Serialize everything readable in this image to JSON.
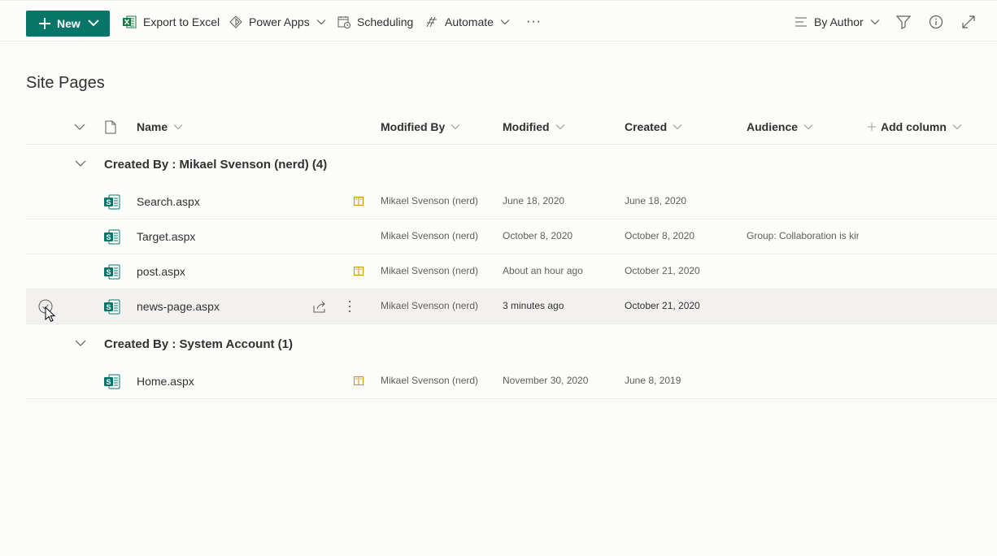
{
  "toolbar": {
    "new_label": "New",
    "export_label": "Export to Excel",
    "powerapps_label": "Power Apps",
    "scheduling_label": "Scheduling",
    "automate_label": "Automate",
    "more_label": "···",
    "view_label": "By Author"
  },
  "page": {
    "title": "Site Pages"
  },
  "columns": {
    "name": "Name",
    "modified_by": "Modified By",
    "modified": "Modified",
    "created": "Created",
    "audience": "Audience",
    "add_column": "Add column"
  },
  "groups": [
    {
      "title": "Created By : Mikael Svenson (nerd) (4)",
      "rows": [
        {
          "name": "Search.aspx",
          "modified_by": "Mikael Svenson (nerd)",
          "modified": "June 18, 2020",
          "created": "June 18, 2020",
          "audience": ""
        },
        {
          "name": "Target.aspx",
          "modified_by": "Mikael Svenson (nerd)",
          "modified": "October 8, 2020",
          "created": "October 8, 2020",
          "audience": "Group: Collaboration is kir"
        },
        {
          "name": "post.aspx",
          "modified_by": "Mikael Svenson (nerd)",
          "modified": "About an hour ago",
          "created": "October 21, 2020",
          "audience": ""
        },
        {
          "name": "news-page.aspx",
          "modified_by": "Mikael Svenson (nerd)",
          "modified": "3 minutes ago",
          "created": "October 21, 2020",
          "audience": ""
        }
      ]
    },
    {
      "title": "Created By : System Account (1)",
      "rows": [
        {
          "name": "Home.aspx",
          "modified_by": "Mikael Svenson (nerd)",
          "modified": "November 30, 2020",
          "created": "June 8, 2019",
          "audience": ""
        }
      ]
    }
  ],
  "colors": {
    "accent": "#077568",
    "book": "#d29200",
    "text": "#323130",
    "subtle": "#605e5c"
  }
}
